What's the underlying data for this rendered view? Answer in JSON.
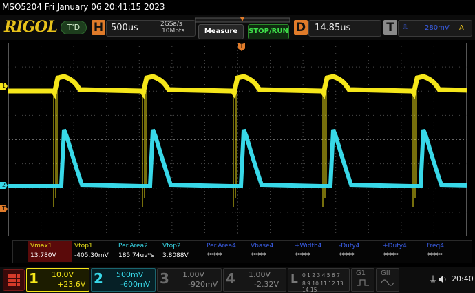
{
  "title_bar": {
    "text": "MSO5204  Fri January 06 20:41:15 2023"
  },
  "header": {
    "logo": "RIGOL",
    "run_state": "T'D",
    "horizontal": {
      "letter": "H",
      "timebase": "500us",
      "sample_rate": "2GSa/s",
      "memory_depth": "10Mpts"
    },
    "measure_button": "Measure",
    "stop_run_button": "STOP/RUN",
    "delay": {
      "letter": "D",
      "value": "14.85us"
    },
    "trigger": {
      "letter": "T",
      "level": "280mV",
      "source_label": "A"
    }
  },
  "measurements": [
    {
      "label": "Vmax1",
      "value": "13.780V",
      "color": "#e8e01a",
      "selected": true
    },
    {
      "label": "Vtop1",
      "value": "-405.30mV",
      "color": "#e8e01a"
    },
    {
      "label": "Per.Area2",
      "value": "185.74uv*s",
      "color": "#38d8e8"
    },
    {
      "label": "Vtop2",
      "value": "3.8088V",
      "color": "#38d8e8"
    },
    {
      "label": "Per.Area4",
      "value": "*****",
      "color": "#3a5ee8"
    },
    {
      "label": "Vbase4",
      "value": "*****",
      "color": "#3a5ee8"
    },
    {
      "label": "+Width4",
      "value": "*****",
      "color": "#3a5ee8"
    },
    {
      "label": "-Duty4",
      "value": "*****",
      "color": "#3a5ee8"
    },
    {
      "label": "+Duty4",
      "value": "*****",
      "color": "#3a5ee8"
    },
    {
      "label": "Freq4",
      "value": "*****",
      "color": "#3a5ee8"
    }
  ],
  "channels": [
    {
      "num": "1",
      "scale": "10.0V",
      "offset": "+23.6V",
      "color": "#f5e61a"
    },
    {
      "num": "2",
      "scale": "500mV",
      "offset": "-600mV",
      "color": "#38d8e8"
    },
    {
      "num": "3",
      "scale": "1.00V",
      "offset": "-920mV",
      "color": "#777777"
    },
    {
      "num": "4",
      "scale": "1.00V",
      "offset": "-2.32V",
      "color": "#777777"
    }
  ],
  "logic": {
    "letter": "L",
    "row1": "0 1 2 3 4 5 6 7",
    "row2": "8 9 10 11 12 13 14 15"
  },
  "g1_label": "G1",
  "g2_label": "GII",
  "clock": "20:40",
  "markers": {
    "ch1": "1",
    "ch2": "2",
    "trig": "T"
  },
  "colors": {
    "ch1": "#f5e61a",
    "ch2": "#38d8e8",
    "trigger": "#e07b2a",
    "grid": "#4a4a4a"
  },
  "icons": [
    "menu-grid-icon",
    "usb-icon",
    "speaker-icon"
  ]
}
